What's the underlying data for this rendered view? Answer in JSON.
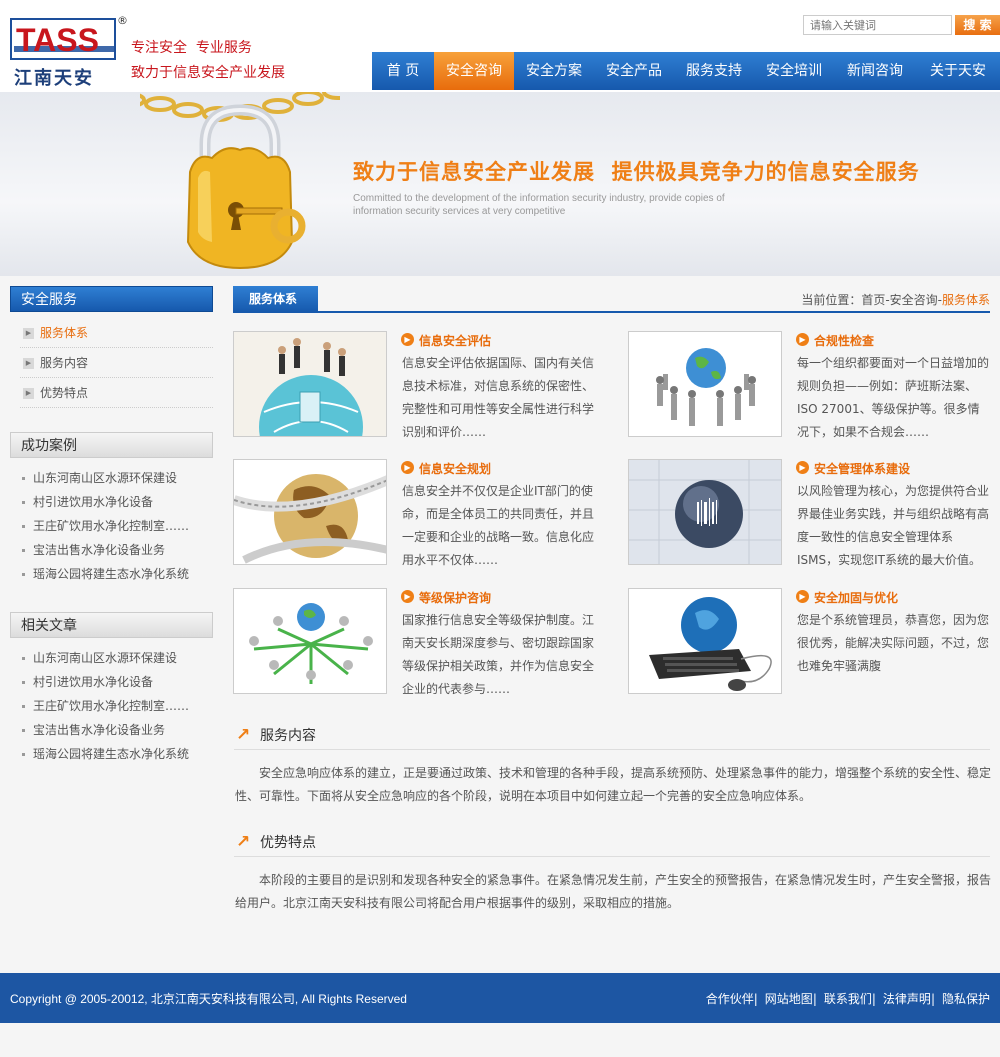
{
  "brand": {
    "logo_text": "TASS",
    "logo_cn": "江南天安",
    "reg": "®",
    "slogan1": "专注安全  专业服务",
    "slogan2": "致力于信息安全产业发展"
  },
  "search": {
    "placeholder": "请输入关键词",
    "button": "搜 索"
  },
  "nav": [
    "首 页",
    "安全咨询",
    "安全方案",
    "安全产品",
    "服务支持",
    "安全培训",
    "新闻咨询",
    "关于天安"
  ],
  "banner": {
    "title": "致力于信息安全产业发展  提供极具竞争力的信息安全服务",
    "subtitle": "Committed to the development of the information security industry, provide copies of information security services at very competitive"
  },
  "sidebar": {
    "services_title": "安全服务",
    "services": [
      "服务体系",
      "服务内容",
      "优势特点"
    ],
    "cases_title": "成功案例",
    "cases": [
      "山东河南山区水源环保建设",
      "村引进饮用水净化设备",
      "王庄矿饮用水净化控制室……",
      "宝洁出售水净化设备业务",
      "瑶海公园将建生态水净化系统"
    ],
    "articles_title": "相关文章",
    "articles": [
      "山东河南山区水源环保建设",
      "村引进饮用水净化设备",
      "王庄矿饮用水净化控制室……",
      "宝洁出售水净化设备业务",
      "瑶海公园将建生态水净化系统"
    ]
  },
  "main": {
    "tab": "服务体系",
    "crumb_prefix": "当前位置：首页-安全咨询-",
    "crumb_current": "服务体系",
    "cards": [
      {
        "title": "信息安全评估",
        "text": "信息安全评估依据国际、国内有关信息技术标准，对信息系统的保密性、完整性和可用性等安全属性进行科学识别和评价……"
      },
      {
        "title": "合规性检查",
        "text": "每一个组织都要面对一个日益增加的规则负担——例如：萨班斯法案、ISO 27001、等级保护等。很多情况下，如果不合规会……"
      },
      {
        "title": "信息安全规划",
        "text": "信息安全并不仅仅是企业IT部门的使命，而是全体员工的共同责任，并且一定要和企业的战略一致。信息化应用水平不仅体……"
      },
      {
        "title": "安全管理体系建设",
        "text": "以风险管理为核心，为您提供符合业界最佳业务实践，并与组织战略有高度一致性的信息安全管理体系ISMS，实现您IT系统的最大价值。"
      },
      {
        "title": "等级保护咨询",
        "text": "国家推行信息安全等级保护制度。江南天安长期深度参与、密切跟踪国家等级保护相关政策，并作为信息安全企业的代表参与……"
      },
      {
        "title": "安全加固与优化",
        "text": "您是个系统管理员，恭喜您，因为您很优秀，能解决实际问题，不过，您也难免牢骚满腹"
      }
    ],
    "content_title": "服务内容",
    "content_text": "安全应急响应体系的建立，正是要通过政策、技术和管理的各种手段，提高系统预防、处理紧急事件的能力，增强整个系统的安全性、稳定性、可靠性。下面将从安全应急响应的各个阶段，说明在本项目中如何建立起一个完善的安全应急响应体系。",
    "advantage_title": "优势特点",
    "advantage_text": "本阶段的主要目的是识别和发现各种安全的紧急事件。在紧急情况发生前，产生安全的预警报告，在紧急情况发生时，产生安全警报，报告给用户。北京江南天安科技有限公司将配合用户根据事件的级别，采取相应的措施。"
  },
  "footer": {
    "copyright": "Copyright @ 2005-20012, 北京江南天安科技有限公司, All Rights Reserved",
    "links": [
      "合作伙伴",
      "网站地图",
      "联系我们",
      "法律声明",
      "隐私保护"
    ],
    "separator": "|"
  },
  "colors": {
    "brand_blue": "#1659ad",
    "accent_orange": "#e86c0c",
    "brand_red": "#c8161d"
  }
}
